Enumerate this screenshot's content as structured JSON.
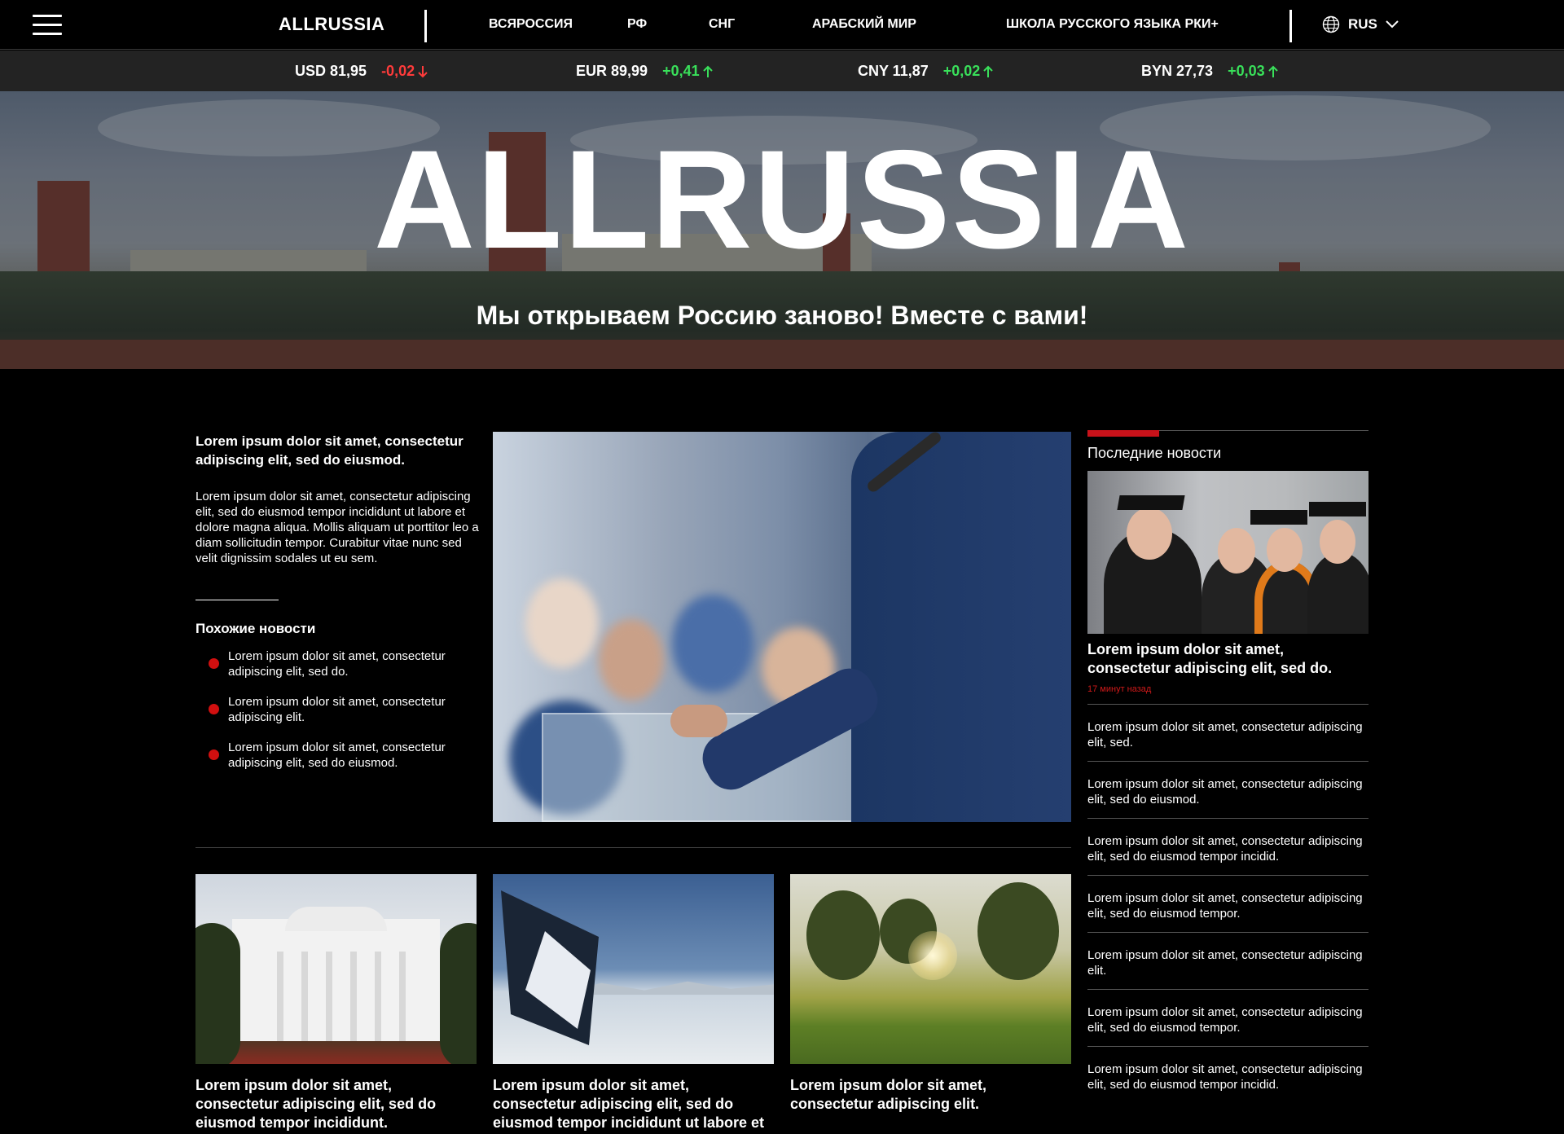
{
  "nav": {
    "logo": "ALLRUSSIA",
    "links": [
      "ВСЯРОССИЯ",
      "РФ",
      "СНГ",
      "АРАБСКИЙ МИР",
      "ШКОЛА РУССКОГО ЯЗЫКА РКИ+"
    ],
    "lang": "RUS",
    "icons": {
      "menu": "hamburger-icon",
      "globe": "globe-icon",
      "chevron": "chevron-down-icon"
    }
  },
  "currencies": [
    {
      "label": "USD 81,95",
      "change": "-0,02",
      "dir": "down"
    },
    {
      "label": "EUR 89,99",
      "change": "+0,41",
      "dir": "up"
    },
    {
      "label": "CNY 11,87",
      "change": "+0,02",
      "dir": "up"
    },
    {
      "label": "BYN 27,73",
      "change": "+0,03",
      "dir": "up"
    }
  ],
  "hero": {
    "title": "ALLRUSSIA",
    "subtitle": "Мы открываем Россию заново! Вместе с вами!"
  },
  "lead": {
    "title": "Lorem ipsum dolor sit amet, consectetur adipiscing elit, sed do eiusmod.",
    "text": "Lorem ipsum dolor sit amet, consectetur adipiscing elit, sed do eiusmod tempor incididunt ut labore et dolore magna aliqua. Mollis aliquam ut porttitor leo a diam sollicitudin tempor. Curabitur vitae nunc sed velit dignissim sodales ut eu sem."
  },
  "related": {
    "title": "Похожие новости",
    "items": [
      "Lorem ipsum dolor sit amet, consectetur adipiscing elit, sed do.",
      "Lorem ipsum dolor sit amet, consectetur adipiscing elit.",
      "Lorem ipsum dolor sit amet, consectetur adipiscing elit, sed do eiusmod."
    ]
  },
  "cards": [
    "Lorem ipsum dolor sit amet, consectetur adipiscing elit, sed do eiusmod tempor incididunt.",
    "Lorem ipsum dolor sit amet, consectetur adipiscing elit, sed do eiusmod tempor incididunt ut labore et dolore magna.",
    "Lorem ipsum dolor sit amet, consectetur adipiscing elit."
  ],
  "latest": {
    "title": "Последние новости",
    "headline": "Lorem ipsum dolor sit amet, consectetur adipiscing elit, sed do.",
    "time": "17 минут назад",
    "items": [
      "Lorem ipsum dolor sit amet, consectetur adipiscing elit, sed.",
      "Lorem ipsum dolor sit amet, consectetur adipiscing elit, sed do eiusmod.",
      "Lorem ipsum dolor sit amet, consectetur adipiscing elit, sed do eiusmod tempor incidid.",
      "Lorem ipsum dolor sit amet, consectetur adipiscing elit, sed do eiusmod tempor.",
      "Lorem ipsum dolor sit amet, consectetur adipiscing elit.",
      "Lorem ipsum dolor sit amet, consectetur adipiscing elit, sed do eiusmod tempor.",
      "Lorem ipsum dolor sit amet, consectetur adipiscing elit, sed do eiusmod tempor incidid."
    ]
  },
  "colors": {
    "accent": "#c8121a",
    "up": "#39e05a",
    "down": "#ff3b3b",
    "bar": "#232323"
  }
}
